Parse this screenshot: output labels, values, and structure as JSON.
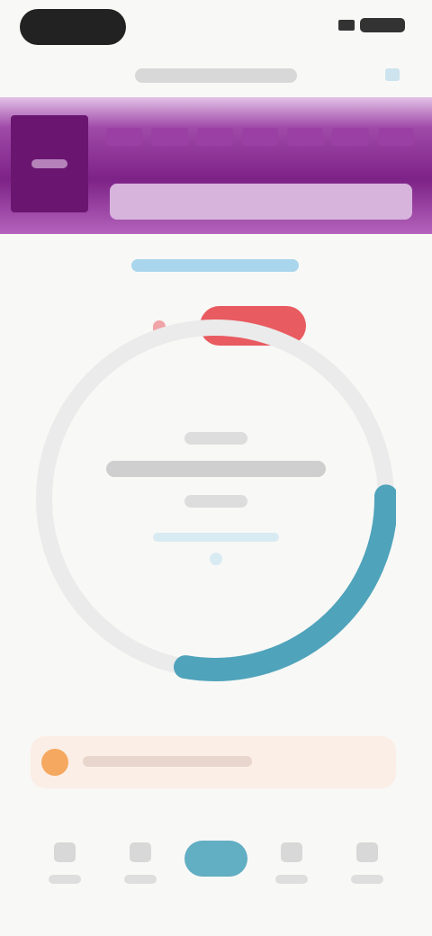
{
  "status_bar": {
    "signal_icon": "signal-icon",
    "battery_icon": "battery-icon"
  },
  "banner": {
    "colors": {
      "primary": "#7d2287",
      "dark": "#6a1670",
      "light": "#d7b4dc"
    }
  },
  "timer": {
    "progress_fraction": 0.28,
    "ring_color": "#4fa3bb",
    "track_color": "#ebebeb"
  },
  "alert": {
    "color": "#e85b60"
  },
  "notice": {
    "icon": "alert-circle-icon",
    "background": "#fbeee6",
    "icon_color": "#f5a85f"
  },
  "nav": {
    "items": [
      {
        "icon": "home-icon",
        "active": false
      },
      {
        "icon": "calendar-icon",
        "active": false
      },
      {
        "icon": "timer-icon",
        "active": true
      },
      {
        "icon": "chart-icon",
        "active": false
      },
      {
        "icon": "profile-icon",
        "active": false
      }
    ],
    "active_color": "#62aec3"
  }
}
